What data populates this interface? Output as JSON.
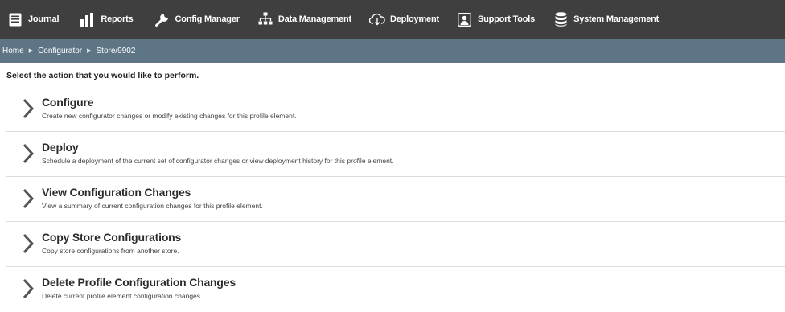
{
  "nav": {
    "items": [
      {
        "label": "Journal",
        "icon": "journal-icon"
      },
      {
        "label": "Reports",
        "icon": "bar-chart-icon"
      },
      {
        "label": "Config Manager",
        "icon": "wrench-icon"
      },
      {
        "label": "Data Management",
        "icon": "hierarchy-icon"
      },
      {
        "label": "Deployment",
        "icon": "cloud-download-icon"
      },
      {
        "label": "Support Tools",
        "icon": "support-user-icon"
      },
      {
        "label": "System Management",
        "icon": "database-icon"
      }
    ]
  },
  "breadcrumb": [
    "Home",
    "Configurator",
    "Store/9902"
  ],
  "prompt": "Select the action that you would like to perform.",
  "actions": [
    {
      "title": "Configure",
      "description": "Create new configurator changes or modify existing changes for this profile element."
    },
    {
      "title": "Deploy",
      "description": "Schedule a deployment of the current set of configurator changes or view deployment history for this profile element."
    },
    {
      "title": "View Configuration Changes",
      "description": "View a summary of current configuration changes for this profile element."
    },
    {
      "title": "Copy Store Configurations",
      "description": "Copy store configurations from another store."
    },
    {
      "title": "Delete Profile Configuration Changes",
      "description": "Delete current profile element configuration changes."
    }
  ],
  "colors": {
    "topbar": "#3f3f3f",
    "breadcrumb_bar": "#5e7585",
    "chevron": "#555555"
  }
}
